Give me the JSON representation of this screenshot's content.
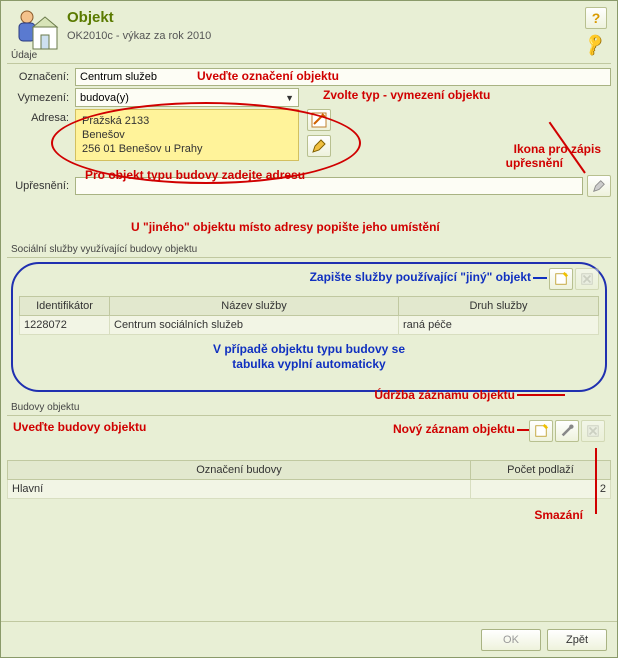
{
  "header": {
    "title": "Objekt",
    "subtitle": "OK2010c - výkaz za rok 2010"
  },
  "udaje": {
    "legend": "Údaje",
    "oznaceni_label": "Označení:",
    "oznaceni_value": "Centrum služeb",
    "vymezeni_label": "Vymezení:",
    "vymezeni_value": "budova(y)",
    "adresa_label": "Adresa:",
    "adresa_line1": "Pražská 2133",
    "adresa_line2": "Benešov",
    "adresa_line3": "256 01 Benešov u Prahy",
    "upresneni_label": "Upřesnění:",
    "upresneni_value": ""
  },
  "annotations": {
    "oznaceni": "Uveďte označení objektu",
    "vymezeni": "Zvolte typ - vymezení objektu",
    "adresa": "Pro objekt typu budovy zadejte adresu",
    "ikona_upresneni1": "Ikona pro zápis",
    "ikona_upresneni2": "upřesnění",
    "upresneni_hint": "U \"jiného\" objektu místo adresy popište jeho umístění",
    "sluzby_hint": "Zapište služby používající \"jiný\" objekt",
    "auto1": "V případě objektu typu budovy se",
    "auto2": "tabulka vyplní automaticky",
    "budovy_hint": "Uveďte budovy objektu",
    "udrzba": "Údržba záznamu objektu",
    "novy": "Nový záznam objektu",
    "smazani": "Smazání"
  },
  "sluzby": {
    "legend": "Sociální služby využívající budovy objektu",
    "col_id": "Identifikátor",
    "col_nazev": "Název služby",
    "col_druh": "Druh služby",
    "rows": [
      {
        "id": "1228072",
        "nazev": "Centrum sociálních služeb",
        "druh": "raná péče"
      }
    ]
  },
  "budovy": {
    "legend": "Budovy objektu",
    "col_oznaceni": "Označení budovy",
    "col_podlazi": "Počet podlaží",
    "rows": [
      {
        "oznaceni": "Hlavní",
        "podlazi": "2"
      }
    ]
  },
  "footer": {
    "ok": "OK",
    "zpet": "Zpět"
  }
}
